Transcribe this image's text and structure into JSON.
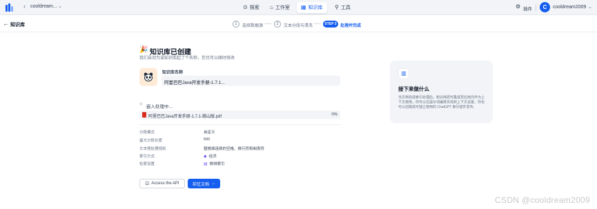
{
  "topbar": {
    "workspace_name": "cooldream...",
    "nav": [
      {
        "icon": "compass-icon",
        "glyph": "⊙",
        "label": "探索"
      },
      {
        "icon": "studio-icon",
        "glyph": "⌂",
        "label": "工作室"
      },
      {
        "icon": "knowledge-icon",
        "glyph": "▦",
        "label": "知识库"
      },
      {
        "icon": "tool-icon",
        "glyph": "⚲",
        "label": "工具"
      }
    ],
    "plugin_label": "插件",
    "avatar_letter": "C",
    "user_name": "cooldream2009"
  },
  "subheader": {
    "title": "知识库",
    "steps": [
      {
        "num": "1",
        "label": "选择数据源"
      },
      {
        "num": "2",
        "label": "文本分段与清洗"
      },
      {
        "num": "STEP 3",
        "label": "处理并完成"
      }
    ]
  },
  "created": {
    "icon": "🎉",
    "title": "知识库已创建",
    "subtitle": "我们自动为该知识库起了个名称，您也可以随时修改",
    "name_label": "知识库名称",
    "name_value": "阿里巴巴Java开发手册-1.7.1..."
  },
  "embedding": {
    "status": "嵌入处理中...",
    "file_name": "阿里巴巴Java开发手册-1.7.1-嵩山版.pdf",
    "progress": "0%"
  },
  "info": [
    {
      "key": "分段模式",
      "value": "自定义",
      "icon": ""
    },
    {
      "key": "最大分段长度",
      "value": "500",
      "icon": ""
    },
    {
      "key": "文本预处理规则",
      "value": "替换掉连续的空格、换行符和制表符",
      "icon": ""
    },
    {
      "key": "索引方式",
      "value": "经济",
      "icon": "◆"
    },
    {
      "key": "检索设置",
      "value": "倒排索引",
      "icon": "▤"
    }
  ],
  "actions": {
    "api_label": "Access the API",
    "doc_label": "前往文档",
    "doc_arrow": "→"
  },
  "side_card": {
    "title": "接下来做什么",
    "description": "当文档完成索引处理后，知识库即可集成至应用内作为上下文使用，你可以在提示词编排页找到上下文设置。你也可以创建成可独立使用的 ChatGPT 索引插件发布。"
  },
  "watermark": "CSDN @cooldream2009",
  "colors": {
    "accent": "#155eef",
    "pdf": "#d92d20"
  }
}
